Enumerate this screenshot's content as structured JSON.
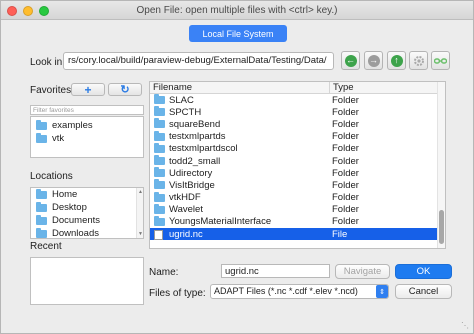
{
  "window": {
    "title": "Open File:  open multiple files with <ctrl> key.)"
  },
  "tabs": {
    "local_file_system": "Local File System"
  },
  "look_in": {
    "label": "Look in:",
    "path": "rs/cory.local/build/paraview-debug/ExternalData/Testing/Data/"
  },
  "nav_buttons": {
    "back_icon": "arrow-left-icon",
    "forward_icon": "arrow-right-icon",
    "up_icon": "arrow-up-icon",
    "settings_icon": "gear-icon",
    "view_icon": "link-icon"
  },
  "favorites": {
    "label": "Favorites",
    "filter_placeholder": "Filter favorites",
    "items": [
      "examples",
      "vtk"
    ]
  },
  "locations": {
    "label": "Locations",
    "items": [
      "Home",
      "Desktop",
      "Documents",
      "Downloads"
    ]
  },
  "recent": {
    "label": "Recent"
  },
  "file_view": {
    "columns": [
      "Filename",
      "Type"
    ],
    "rows": [
      {
        "name": "SLAC",
        "type": "Folder"
      },
      {
        "name": "SPCTH",
        "type": "Folder"
      },
      {
        "name": "squareBend",
        "type": "Folder"
      },
      {
        "name": "testxmlpartds",
        "type": "Folder"
      },
      {
        "name": "testxmlpartdscol",
        "type": "Folder"
      },
      {
        "name": "todd2_small",
        "type": "Folder"
      },
      {
        "name": "Udirectory",
        "type": "Folder"
      },
      {
        "name": "VisItBridge",
        "type": "Folder"
      },
      {
        "name": "vtkHDF",
        "type": "Folder"
      },
      {
        "name": "Wavelet",
        "type": "Folder"
      },
      {
        "name": "YoungsMaterialInterface",
        "type": "Folder"
      },
      {
        "name": "ugrid.nc",
        "type": "File"
      }
    ],
    "selected": "ugrid.nc"
  },
  "name_field": {
    "label": "Name:",
    "value": "ugrid.nc"
  },
  "file_type": {
    "label": "Files of type:",
    "value": "ADAPT Files (*.nc *.cdf *.elev *.ncd)"
  },
  "buttons": {
    "navigate": "Navigate",
    "ok": "OK",
    "cancel": "Cancel"
  },
  "colors": {
    "accent": "#1e7bf0",
    "selection": "#1660e8",
    "folder": "#6ab4e8"
  }
}
